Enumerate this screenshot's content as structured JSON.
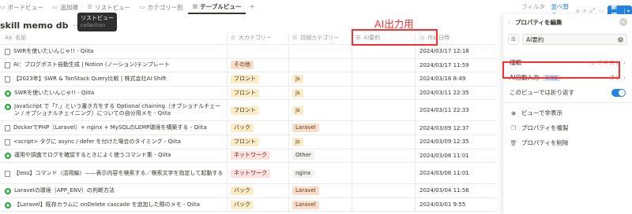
{
  "tabs": [
    {
      "icon": "▭",
      "label": "ボードビュー",
      "name": "tab-board-view"
    },
    {
      "icon": "▭",
      "label": "追加順",
      "name": "tab-added-order"
    },
    {
      "icon": "☰",
      "label": "リストビュー",
      "name": "tab-list-view"
    },
    {
      "icon": "▭",
      "label": "カテゴリー別",
      "name": "tab-by-category"
    },
    {
      "icon": "▦",
      "label": "テーブルビュー",
      "name": "tab-table-view"
    }
  ],
  "add_tab": "+",
  "tooltip": {
    "title": "リストビュー",
    "sub": "collection"
  },
  "toolbar": {
    "filter": "フィルター",
    "sort": "並べ替え",
    "new_label": "新規",
    "new_caret": "▾",
    "lightning": "⚡",
    "search": "⌕",
    "expand": "⤢",
    "more": "···"
  },
  "db": {
    "title": "skill memo db",
    "more": "···"
  },
  "annotation": {
    "label": "AI出力用"
  },
  "columns": {
    "name": {
      "icon": "Aa",
      "label": "名前"
    },
    "category": {
      "icon": "⊙",
      "label": "大カテゴリー"
    },
    "detail": {
      "icon": "☷",
      "label": "詳細カテゴリー"
    },
    "ai": {
      "icon": "☰",
      "label": "AI要約"
    },
    "date": {
      "icon": "◷",
      "label": "作成日時"
    }
  },
  "rows": [
    {
      "icon": "doc",
      "name": "SWRを使いたいんじゃ!! - Qiita",
      "category": "",
      "detail": "",
      "ai": "",
      "date": "2024/03/17 12:18"
    },
    {
      "icon": "doc",
      "name": "AI：ブログポスト自動生成 | Notion (ノーション)テンプレート",
      "category": "その他",
      "detail": "",
      "ai": "",
      "date": "2024/03/17 11:59"
    },
    {
      "icon": "doc",
      "name": "【2023年】SWR & TanStack Query比較 | 株式会社AI Shift",
      "category": "フロント",
      "detail": "js",
      "ai": "",
      "date": "2024/03/16 8:49"
    },
    {
      "icon": "globe",
      "name": "SWRを使いたいんじゃ!! - Qiita",
      "category": "フロント",
      "detail": "js",
      "ai": "",
      "date": "2024/03/11 22:35"
    },
    {
      "icon": "globe",
      "name": "JavaScript で「?.」という書き方をする Optional chaining（オプショナルチェーン / オプショナルチェイニング）についての自分用メモ - Qiita",
      "category": "フロント",
      "detail": "js",
      "ai": "",
      "date": "2024/03/11 22:33",
      "tall": true
    },
    {
      "icon": "doc",
      "name": "DockerでPHP（Laravel）+ nginx + MySQLのLEMP環境を構築する - Qiita",
      "category": "バック",
      "detail": "Laravel",
      "ai": "",
      "date": "2024/03/09 12:37"
    },
    {
      "icon": "doc",
      "name": "<script> タグに async / defer を付けた場合のタイミング - Qiita",
      "category": "フロント",
      "detail": "js",
      "ai": "",
      "date": "2024/03/09 12:35"
    },
    {
      "icon": "globe",
      "name": "運用や調査でログを確認するときによく使うコマンド集 - Qiita",
      "category": "ネットワーク",
      "detail": "Other",
      "ai": "",
      "date": "2024/03/06 11:01"
    },
    {
      "icon": "doc",
      "name": "【less】コマンド（活用編）——表示内容を検索する／検索文字を指定して起動する",
      "category": "ネットワーク",
      "detail": "nginx",
      "ai": "",
      "date": "2024/03/06 11:01",
      "tall": true
    },
    {
      "icon": "globe",
      "name": "Laravelの環境（APP_ENV）の判断方法",
      "category": "バック",
      "detail": "Laravel",
      "ai": "",
      "date": "2024/03/04 11:56"
    },
    {
      "icon": "globe",
      "name": "【Laravel】既存カラムに onDelete cascade を追加した際のメモ - Qiita",
      "category": "バック",
      "detail": "Laravel",
      "ai": "",
      "date": "2024/03/01 9:55"
    }
  ],
  "tag_colors": {
    "その他": {
      "bg": "#fadec9",
      "fg": "#5c3b23"
    },
    "フロント": {
      "bg": "#fdecc8",
      "fg": "#402c1b"
    },
    "バック": {
      "bg": "#fdecc8",
      "fg": "#402c1b"
    },
    "ネットワーク": {
      "bg": "#ffe2dd",
      "fg": "#5d1715"
    },
    "js": {
      "bg": "#fdecc8",
      "fg": "#402c1b"
    },
    "Laravel": {
      "bg": "#fadec9",
      "fg": "#5c3b23"
    },
    "Other": {
      "bg": "#f1f1ef",
      "fg": "#37352f"
    },
    "nginx": {
      "bg": "#f1f1ef",
      "fg": "#37352f"
    }
  },
  "panel": {
    "title": "プロパティを編集",
    "back": "‹",
    "close": "✕",
    "name_icon": "☰",
    "name_value": "AI要約",
    "info": "i",
    "type_label": "種類",
    "type_value": "テキスト",
    "type_icon": "≡",
    "chevron": "›",
    "ai_auto_label": "AI自動入力",
    "ai_auto_badge": "新機能",
    "ai_auto_value": "オフ",
    "wrap_label": "このビューでは折り返す",
    "actions": [
      {
        "icon": "◉",
        "label": "ビューで非表示",
        "name": "hide-in-view-button"
      },
      {
        "icon": "❐",
        "label": "プロパティを複製",
        "name": "duplicate-property-button"
      },
      {
        "icon": "🗑",
        "label": "プロパティを削除",
        "name": "delete-property-button"
      }
    ]
  }
}
